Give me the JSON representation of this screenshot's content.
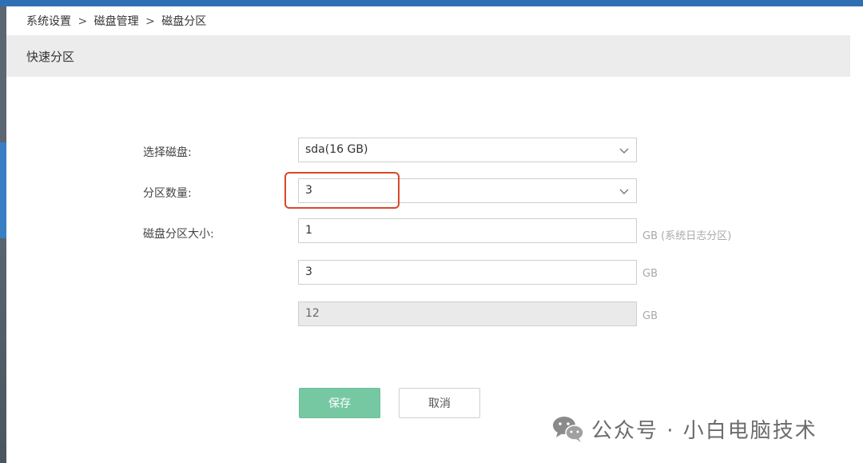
{
  "breadcrumb": {
    "items": [
      "系统设置",
      "磁盘管理",
      "磁盘分区"
    ],
    "separator": ">"
  },
  "section": {
    "title": "快速分区"
  },
  "form": {
    "disk": {
      "label": "选择磁盘:",
      "value": "sda(16 GB)"
    },
    "partition_count": {
      "label": "分区数量:",
      "value": "3"
    },
    "partition_size": {
      "label": "磁盘分区大小:",
      "fields": [
        {
          "value": "1",
          "unit": "GB (系统日志分区)"
        },
        {
          "value": "3",
          "unit": "GB"
        },
        {
          "value": "12",
          "unit": "GB"
        }
      ]
    }
  },
  "buttons": {
    "save": "保存",
    "cancel": "取消"
  },
  "watermark": {
    "text": "公众号 · 小白电脑技术"
  },
  "colors": {
    "save_button": "#76c8a3",
    "highlight": "#d9472b",
    "header_bg": "#ececec",
    "top_bar": "#2f6fb3"
  }
}
